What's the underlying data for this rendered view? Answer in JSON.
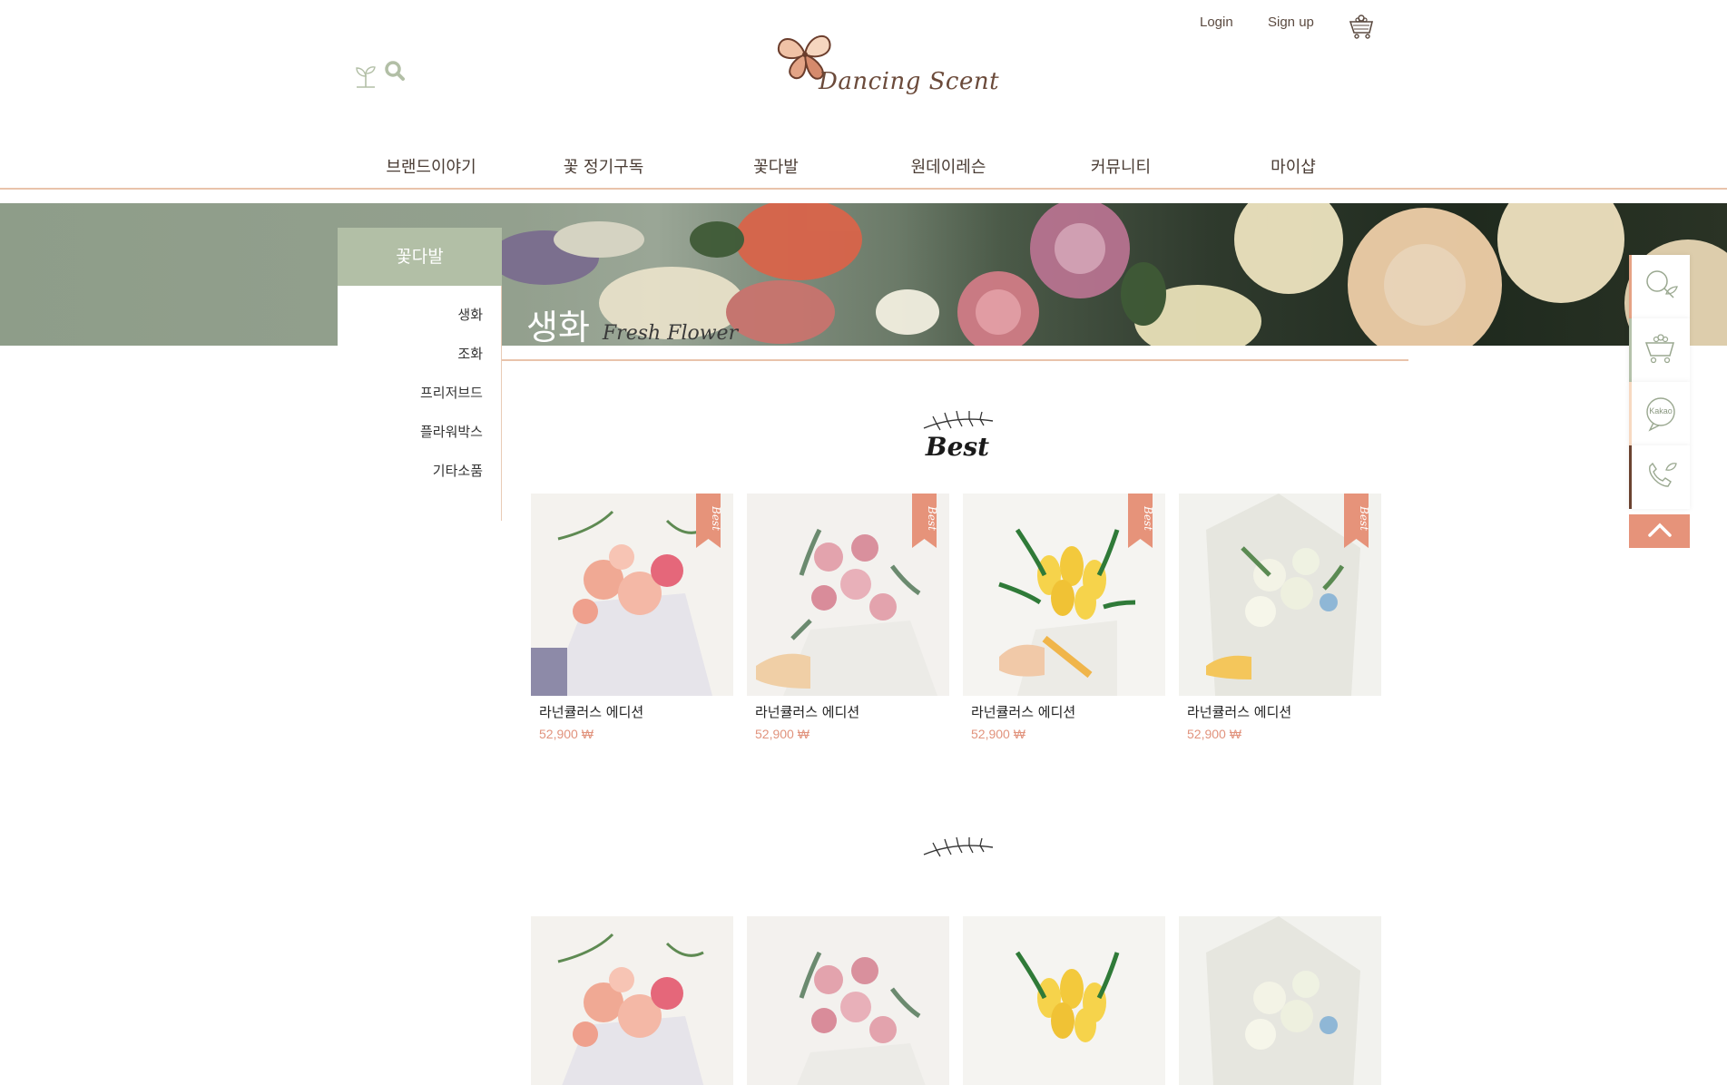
{
  "header": {
    "logo_text": "Dancing Scent",
    "login_label": "Login",
    "signup_label": "Sign up",
    "search_icon": "search-icon",
    "sprout_icon": "sprout-icon",
    "cart_icon": "flower-basket-icon"
  },
  "nav": {
    "items": [
      {
        "label": "브랜드이야기"
      },
      {
        "label": "꽃 정기구독"
      },
      {
        "label": "꽃다발"
      },
      {
        "label": "원데이레슨"
      },
      {
        "label": "커뮤니티"
      },
      {
        "label": "마이샵"
      }
    ]
  },
  "side": {
    "title": "꽃다발",
    "items": [
      {
        "label": "생화"
      },
      {
        "label": "조화"
      },
      {
        "label": "프리저브드"
      },
      {
        "label": "플라워박스"
      },
      {
        "label": "기타소품"
      }
    ]
  },
  "page": {
    "title_kr": "생화",
    "title_en": "Fresh Flower"
  },
  "best": {
    "title": "Best",
    "products": [
      {
        "name": "라넌큘러스 에디션",
        "price": "52,900 ₩",
        "badge": "Best"
      },
      {
        "name": "라넌큘러스 에디션",
        "price": "52,900 ₩",
        "badge": "Best"
      },
      {
        "name": "라넌큘러스 에디션",
        "price": "52,900 ₩",
        "badge": "Best"
      },
      {
        "name": "라넌큘러스 에디션",
        "price": "52,900 ₩",
        "badge": "Best"
      }
    ]
  },
  "quick": {
    "items": [
      {
        "icon": "search-leaf-icon"
      },
      {
        "icon": "cart-flower-icon"
      },
      {
        "icon": "kakao-icon",
        "label": "Kakao"
      },
      {
        "icon": "phone-leaf-icon"
      }
    ],
    "top_icon": "chevron-up-icon"
  },
  "colors": {
    "accent": "#e6937a",
    "sage": "#b2bfa6",
    "line": "#e9c3ab",
    "price": "#e1937d"
  }
}
